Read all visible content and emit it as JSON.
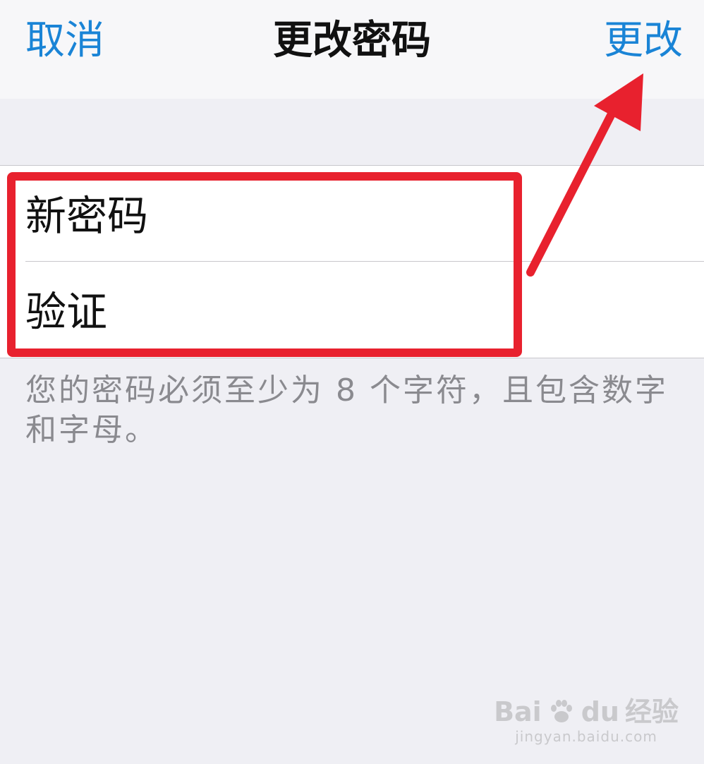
{
  "nav": {
    "cancel_label": "取消",
    "title": "更改密码",
    "change_label": "更改"
  },
  "form": {
    "new_password_label": "新密码",
    "new_password_value": "",
    "verify_label": "验证",
    "verify_value": ""
  },
  "hint": "您的密码必须至少为 8 个字符，且包含数字和字母。",
  "watermark": {
    "brand_left": "Bai",
    "brand_right": "du",
    "brand_cn": "经验",
    "url": "jingyan.baidu.com"
  },
  "colors": {
    "accent": "#1a84d6",
    "annotation_red": "#e8212e",
    "background": "#efeff4",
    "hint_text": "#8a8a8f"
  }
}
